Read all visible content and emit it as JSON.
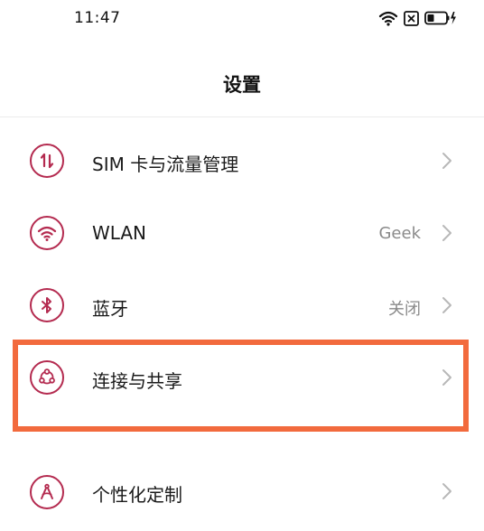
{
  "status_bar": {
    "time": "11:47",
    "icons": [
      "wifi-icon",
      "close-box-icon",
      "battery-charging-icon"
    ]
  },
  "header": {
    "title": "设置"
  },
  "settings": {
    "items": [
      {
        "label": "SIM 卡与流量管理",
        "value": "",
        "icon": "sim-data-icon"
      },
      {
        "label": "WLAN",
        "value": "Geek",
        "icon": "wifi-icon"
      },
      {
        "label": "蓝牙",
        "value": "关闭",
        "icon": "bluetooth-icon"
      },
      {
        "label": "连接与共享",
        "value": "",
        "icon": "connection-sharing-icon"
      },
      {
        "label": "个性化定制",
        "value": "",
        "icon": "personalization-icon"
      }
    ]
  },
  "highlight": {
    "target": "连接与共享",
    "color": "#f26a3d"
  },
  "colors": {
    "accent": "#b42a4f",
    "value_text": "#8a8a8a",
    "chevron": "#b8b8b8"
  }
}
